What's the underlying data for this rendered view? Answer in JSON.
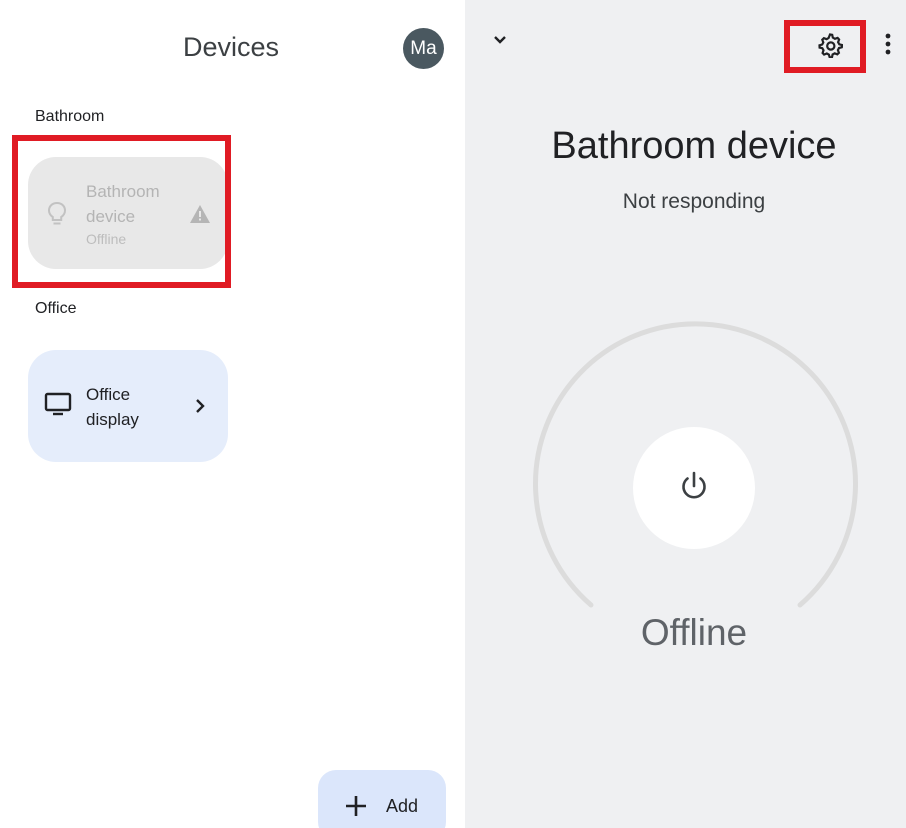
{
  "devices_panel": {
    "title": "Devices",
    "avatar_initials": "Ma",
    "sections": [
      {
        "label": "Bathroom",
        "device": {
          "name": "Bathroom device",
          "status": "Offline",
          "icon": "lightbulb-icon",
          "badge_icon": "warning-icon"
        }
      },
      {
        "label": "Office",
        "device": {
          "name": "Office display",
          "icon": "display-icon",
          "trailing_icon": "chevron-right-icon"
        }
      }
    ],
    "add_button": {
      "label": "Add",
      "icon": "plus-icon"
    }
  },
  "detail_panel": {
    "collapse_icon": "chevron-down-icon",
    "settings_icon": "gear-icon",
    "more_icon": "more-vert-icon",
    "device_name": "Bathroom device",
    "status_text": "Not responding",
    "power_icon": "power-icon",
    "state_label": "Offline"
  },
  "colors": {
    "highlight": "#e01b24",
    "avatar_bg": "#4a5860",
    "offline_card_bg": "#e8e8e8",
    "online_card_bg": "#e5edfb",
    "detail_bg": "#eff0f2",
    "add_button_bg": "#dbe6fb"
  }
}
